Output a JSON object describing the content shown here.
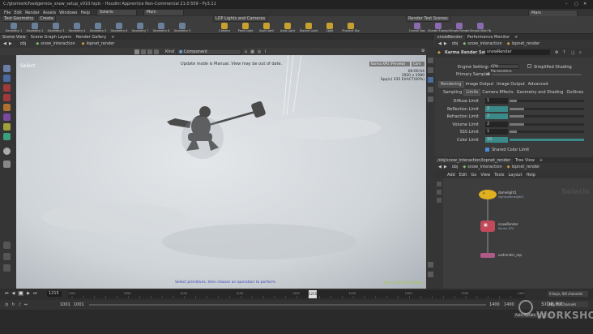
{
  "window": {
    "title": "C:/gtomiork/fxedgemiov_snow_setup_v010.hiplc - Houdini Apprentice Non-Commercial 21.0.559 - Py3.11"
  },
  "menu": [
    "File",
    "Edit",
    "Render",
    "Assets",
    "Windows",
    "Help"
  ],
  "toolbar": {
    "desktop": "Solaris",
    "workspace": "Main",
    "right_desktop": "Main"
  },
  "shelf_tabs_left": [
    "Test Geometry",
    "Create"
  ],
  "shelf_tools_left": [
    "Geometry 1",
    "Geometry 2",
    "Geometry 3",
    "Geometry 4",
    "Geometry 5",
    "Geometry 6",
    "Geometry 7",
    "Geometry 8",
    "Geometry 9"
  ],
  "shelf_tabs_mid": [
    "LOP Lights and Cameras"
  ],
  "shelf_tools_mid": [
    "Camera",
    "Point Light",
    "Spot Light",
    "Area Light",
    "Distant Light",
    "Light",
    "Physical Sky"
  ],
  "shelf_tabs_right": [
    "Render Test Scenes"
  ],
  "shelf_tools_right": [
    "Cornell Box",
    "Shader Example",
    "Simple Render",
    "Simple Multi Render"
  ],
  "pane_tabs_left": [
    "Scene View",
    "Scene Graph Layers",
    "Render Gallery"
  ],
  "path": {
    "context": "obj",
    "node": "snow_interaction",
    "lop": "lopnet_render"
  },
  "viewport": {
    "mode_label": "Component",
    "banner": "Update mode is Manual. View may be out of date.",
    "tool_label": "Select",
    "render_label": "Karma XPU (Preview)",
    "camera_label": "Cam",
    "stats": [
      "00:00:04",
      "1920 x 1080",
      "Spp(s) 335 EXACT(00%)"
    ],
    "hint": "Select primitives, then choose an operation to perform.",
    "corner_label": "Non-Commercial Edition"
  },
  "timeline": {
    "frame": "1215",
    "start": "1001",
    "end": "1400",
    "range_start": "1001",
    "range_end": "1400",
    "marker": "1215",
    "sub_start": "1001",
    "sub_end": "1402",
    "keys_label": "0 keys, 0/0 channels",
    "keyall_label": "Key All Channels",
    "ticks": [
      "1001",
      "1050",
      "1100",
      "1150",
      "1200",
      "1250",
      "1300",
      "1350",
      "1400"
    ]
  },
  "right_tabs": [
    "snowRender",
    "Performance Monitor"
  ],
  "param": {
    "header": "Karma Render Settings",
    "node_name": "snowRender",
    "engine_label": "Engine Settings",
    "engine_value": "CPU Parameters",
    "simplified": "Simplified Shading",
    "primary_label": "Primary Samples",
    "primary_value": "4",
    "tabs": [
      "Rendering",
      "Image Output",
      "Image Output",
      "Advanced"
    ],
    "subtabs": [
      "Sampling",
      "Limits",
      "Camera Effects",
      "Geometry and Shading",
      "Outlines"
    ],
    "rows": [
      {
        "label": "Diffuse Limit",
        "value": "1",
        "fill": 0.1
      },
      {
        "label": "Reflection Limit",
        "value": "2",
        "fill": 0.2
      },
      {
        "label": "Refraction Limit",
        "value": "2",
        "fill": 0.2
      },
      {
        "label": "Volume Limit",
        "value": "2",
        "fill": 0.2
      },
      {
        "label": "SSS Limit",
        "value": "1",
        "fill": 0.1
      },
      {
        "label": "Color Limit",
        "value": "10",
        "fill": 1.0
      }
    ],
    "checkbox": "Shared Color Limit"
  },
  "network": {
    "tabs": [
      "/obj/snow_interaction/lopnet_render",
      "Tree View"
    ],
    "menu": [
      "Add",
      "Edit",
      "Go",
      "View",
      "Tools",
      "Layout",
      "Help"
    ],
    "watermark": "Solaris",
    "nodes": [
      {
        "name": "domelight1",
        "sub": "/lights/domelight1"
      },
      {
        "name": "snowRender",
        "sub": "Karma XPU"
      },
      {
        "name": "usdrender_rop",
        "sub": ""
      }
    ]
  },
  "brand": {
    "text": "WORKSHOP",
    "top": "SIDE FX"
  }
}
